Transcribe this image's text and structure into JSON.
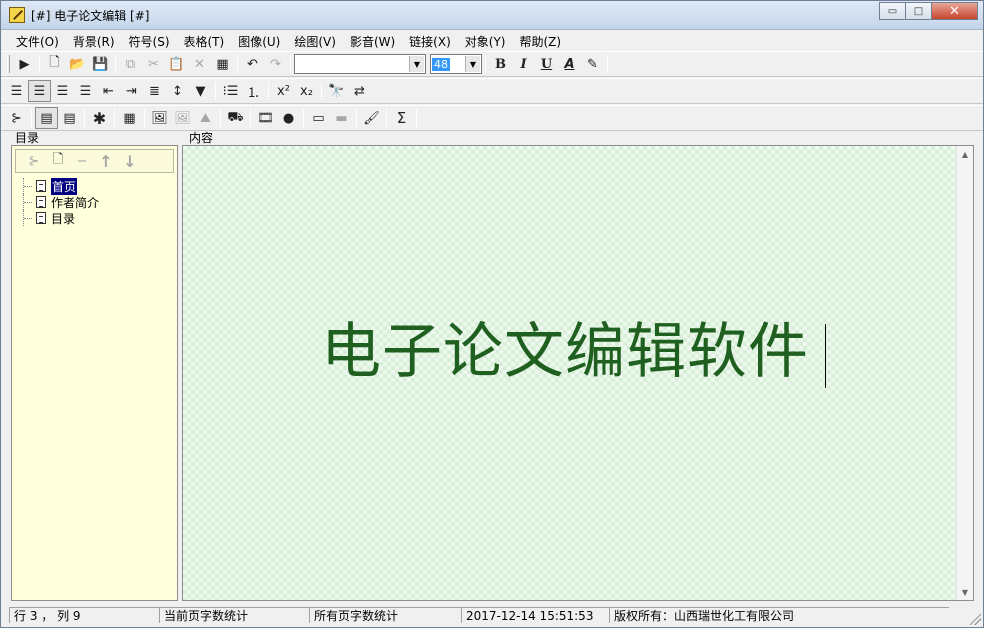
{
  "window": {
    "title": "[#] 电子论文编辑 [#]"
  },
  "window_controls": {
    "minimize": "▭",
    "maximize": "□",
    "close": "✕"
  },
  "menu": [
    "文件(O)",
    "背景(R)",
    "符号(S)",
    "表格(T)",
    "图像(U)",
    "绘图(V)",
    "影音(W)",
    "链接(X)",
    "对象(Y)",
    "帮助(Z)"
  ],
  "toolbar1": {
    "font_name": "",
    "font_size": "48",
    "bold": "B",
    "italic": "I",
    "underline": "U",
    "font_color": "A"
  },
  "toolbar2": {
    "superscript": "x²",
    "subscript": "x₂"
  },
  "toolbar3": {
    "sigma": "Σ",
    "asterisk": "✱"
  },
  "left_panel": {
    "label": "目录",
    "tree": [
      {
        "label": "首页",
        "selected": true
      },
      {
        "label": "作者简介",
        "selected": false
      },
      {
        "label": "目录",
        "selected": false
      }
    ]
  },
  "content": {
    "label": "内容",
    "heading": "电子论文编辑软件"
  },
  "status": {
    "position": "行 3 ， 列 9",
    "page_word_count": "当前页字数统计",
    "all_word_count": "所有页字数统计",
    "datetime": "2017-12-14 15:51:53",
    "copyright": "版权所有：山西瑞世化工有限公司"
  },
  "colors": {
    "heading": "#1f5f1f",
    "tree_bg": "#ffffdc",
    "content_bg": "#eef8ee"
  }
}
